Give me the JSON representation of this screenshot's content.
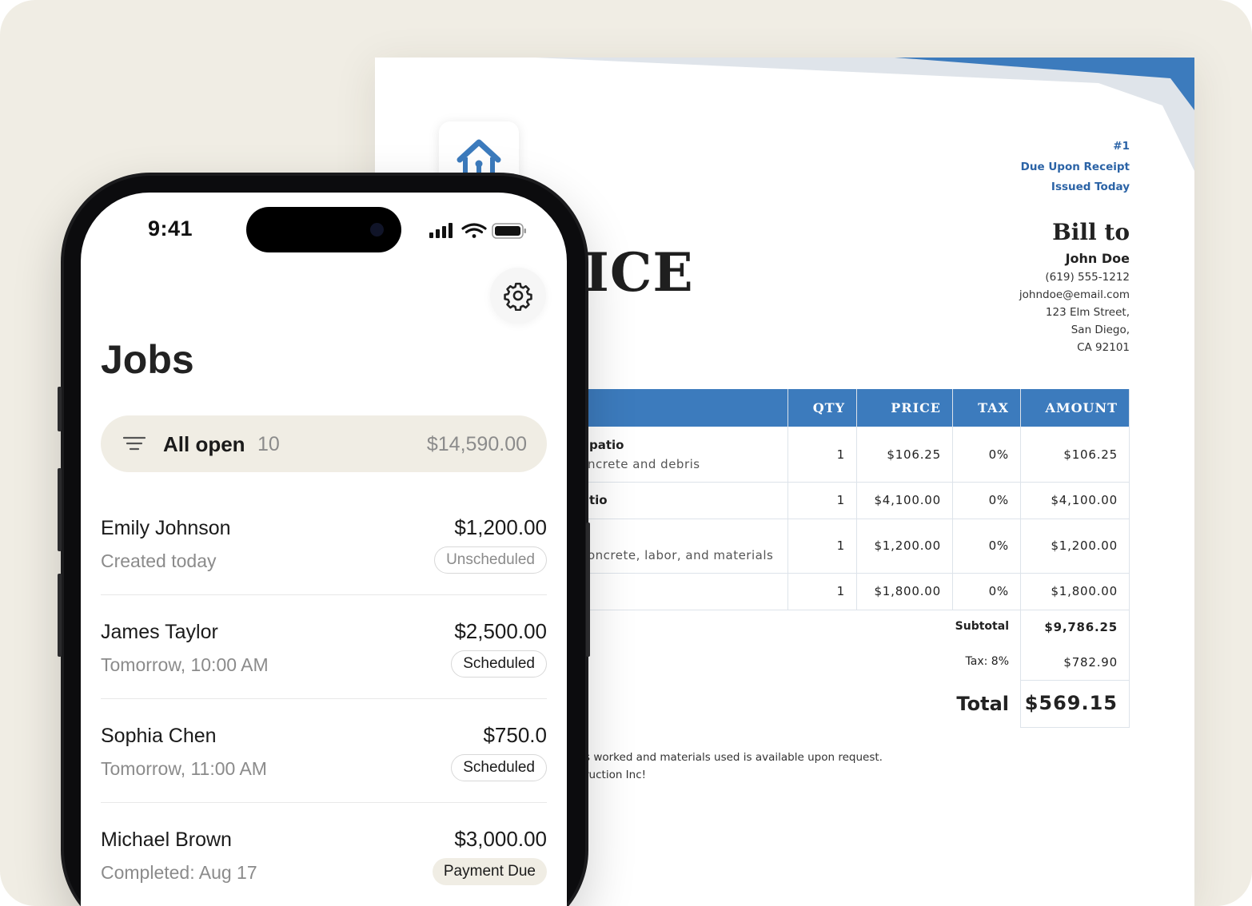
{
  "invoice": {
    "number": "#1",
    "due": "Due Upon Receipt",
    "issued": "Issued Today",
    "title": "ICE",
    "bill_to": {
      "heading": "Bill to",
      "name": "John Doe",
      "phone": "(619) 555-1212",
      "email": "johndoe@email.com",
      "address_1": "123 Elm Street,",
      "address_2": "San Diego,",
      "address_3": "CA 92101"
    },
    "columns": [
      "QTY",
      "PRICE",
      "TAX",
      "AMOUNT"
    ],
    "rows": [
      {
        "title": "patio",
        "sub": "ncrete and debris",
        "qty": "1",
        "price": "$106.25",
        "tax": "0%",
        "amount": "$106.25"
      },
      {
        "title": "tio",
        "sub": "",
        "qty": "1",
        "price": "$4,100.00",
        "tax": "0%",
        "amount": "$4,100.00"
      },
      {
        "title": "",
        "sub": "oncrete, labor, and materials",
        "qty": "1",
        "price": "$1,200.00",
        "tax": "0%",
        "amount": "$1,200.00"
      },
      {
        "title": "",
        "sub": "",
        "qty": "1",
        "price": "$1,800.00",
        "tax": "0%",
        "amount": "$1,800.00"
      }
    ],
    "subtotal_label": "Subtotal",
    "subtotal_value": "$9,786.25",
    "tax_label": "Tax: 8%",
    "tax_value": "$782.90",
    "total_label": "Total",
    "total_value": "$569.15",
    "note_1": "s worked and materials used is available upon request.",
    "note_2": "ruction Inc!",
    "accent_color": "#3c7bbd"
  },
  "phone": {
    "status": {
      "time": "9:41"
    },
    "icons": [
      "settings-gear-icon",
      "filter-lines-icon",
      "cellular-signal-icon",
      "wifi-icon",
      "battery-icon"
    ],
    "title": "Jobs",
    "filter": {
      "label": "All open",
      "count": "10",
      "amount": "$14,590.00"
    },
    "jobs": [
      {
        "name": "Emily Johnson",
        "amount": "$1,200.00",
        "time": "Created today",
        "status": "Unscheduled"
      },
      {
        "name": "James Taylor",
        "amount": "$2,500.00",
        "time": "Tomorrow, 10:00 AM",
        "status": "Scheduled"
      },
      {
        "name": "Sophia Chen",
        "amount": "$750.0",
        "time": "Tomorrow, 11:00 AM",
        "status": "Scheduled"
      },
      {
        "name": "Michael Brown",
        "amount": "$3,000.00",
        "time": "Completed: Aug 17",
        "status": "Payment Due"
      }
    ]
  }
}
